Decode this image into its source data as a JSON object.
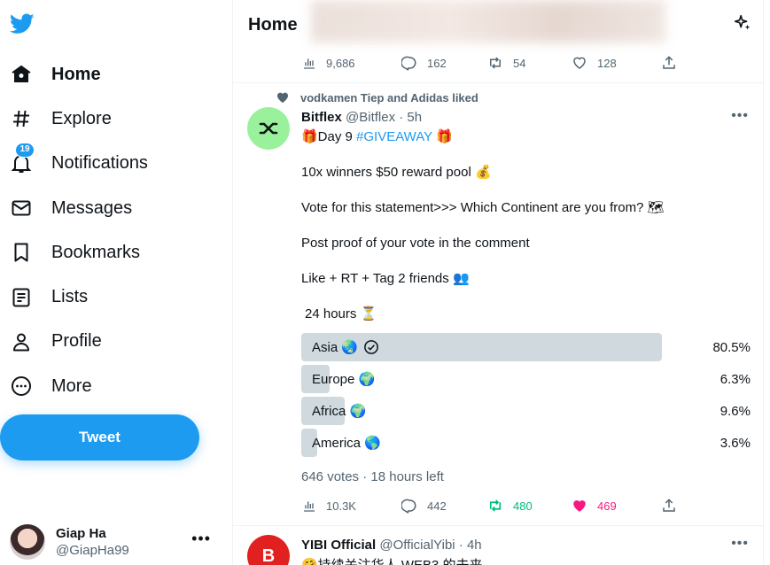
{
  "nav": {
    "items": [
      {
        "label": "Home",
        "icon": "home-icon",
        "active": true
      },
      {
        "label": "Explore",
        "icon": "hashtag-icon"
      },
      {
        "label": "Notifications",
        "icon": "bell-icon",
        "badge": "19"
      },
      {
        "label": "Messages",
        "icon": "envelope-icon"
      },
      {
        "label": "Bookmarks",
        "icon": "bookmark-icon"
      },
      {
        "label": "Lists",
        "icon": "list-icon"
      },
      {
        "label": "Profile",
        "icon": "person-icon"
      },
      {
        "label": "More",
        "icon": "more-circle-icon"
      }
    ],
    "tweet_button": "Tweet"
  },
  "account": {
    "name": "Giap Ha",
    "handle": "@GiapHa99"
  },
  "header": {
    "title": "Home"
  },
  "prev_post": {
    "views": "9,686",
    "replies": "162",
    "retweets": "54",
    "likes": "128"
  },
  "post": {
    "social_context": "vodkamen Tiep and Adidas liked",
    "name": "Bitflex",
    "handle": "@Bitflex",
    "time": "· 5h",
    "line1_pre": "🎁Day 9 ",
    "hashtag": "#GIVEAWAY",
    "line1_post": " 🎁",
    "line2": "10x winners $50 reward pool 💰",
    "line3": "Vote for this statement>>> Which Continent are you from? 🗺",
    "line4": "Post proof of your vote in the comment",
    "line5": "Like + RT + Tag 2 friends 👥",
    "line6": "24 hours ⏳",
    "poll": [
      {
        "label": "Asia 🌏",
        "pct": "80.5%",
        "value": 80.5,
        "selected": true
      },
      {
        "label": "Europe 🌍",
        "pct": "6.3%",
        "value": 6.3
      },
      {
        "label": "Africa 🌍",
        "pct": "9.6%",
        "value": 9.6
      },
      {
        "label": "America 🌎",
        "pct": "3.6%",
        "value": 3.6
      }
    ],
    "poll_meta": "646 votes · 18 hours left",
    "views": "10.3K",
    "replies": "442",
    "retweets": "480",
    "likes": "469",
    "retweet_color": "#00ba7c",
    "like_color": "#f91880"
  },
  "next_post": {
    "name": "YIBI Official",
    "handle": "@OfficialYibi",
    "time": "· 4h",
    "text": "🤗持续关注华人 WEB3 的未来"
  },
  "colors": {
    "accent": "#1d9bf0",
    "muted": "#536471"
  }
}
